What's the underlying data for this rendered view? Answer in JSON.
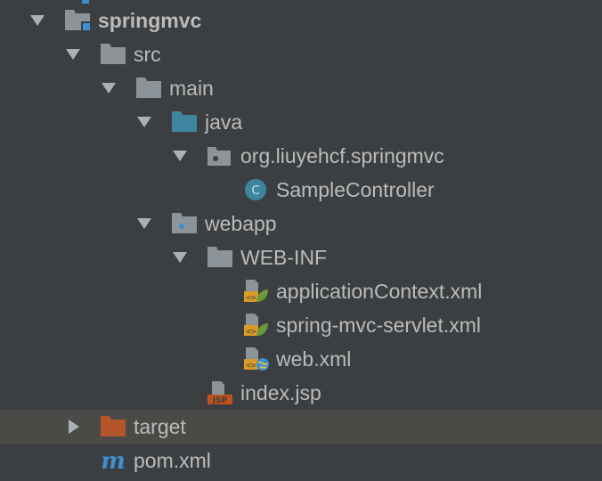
{
  "tree": {
    "rows": [
      {
        "label": "springmvc",
        "icon": "module-folder-icon",
        "expanded": true,
        "bold": true
      },
      {
        "label": "src",
        "icon": "folder-icon",
        "expanded": true
      },
      {
        "label": "main",
        "icon": "folder-icon",
        "expanded": true
      },
      {
        "label": "java",
        "icon": "source-folder-icon",
        "expanded": true
      },
      {
        "label": "org.liuyehcf.springmvc",
        "icon": "package-icon",
        "expanded": true
      },
      {
        "label": "SampleController",
        "icon": "java-class-icon"
      },
      {
        "label": "webapp",
        "icon": "web-folder-icon",
        "expanded": true
      },
      {
        "label": "WEB-INF",
        "icon": "folder-icon",
        "expanded": true
      },
      {
        "label": "applicationContext.xml",
        "icon": "spring-xml-icon"
      },
      {
        "label": "spring-mvc-servlet.xml",
        "icon": "spring-xml-icon"
      },
      {
        "label": "web.xml",
        "icon": "web-xml-icon"
      },
      {
        "label": "index.jsp",
        "icon": "jsp-file-icon",
        "badge": "JSP"
      },
      {
        "label": "target",
        "icon": "excluded-folder-icon",
        "expanded": false,
        "selected": true
      },
      {
        "label": "pom.xml",
        "icon": "maven-icon",
        "badge": "m"
      }
    ]
  },
  "colors": {
    "background": "#3c3f41",
    "selection": "#4b4a47",
    "text": "#bbbbbb",
    "folder": "#8c9499",
    "source_folder": "#3e86a0",
    "target_folder": "#b5552a",
    "accent_blue": "#3d8fd1",
    "spring_green": "#6a9a3a",
    "xml_orange": "#d89b28"
  }
}
